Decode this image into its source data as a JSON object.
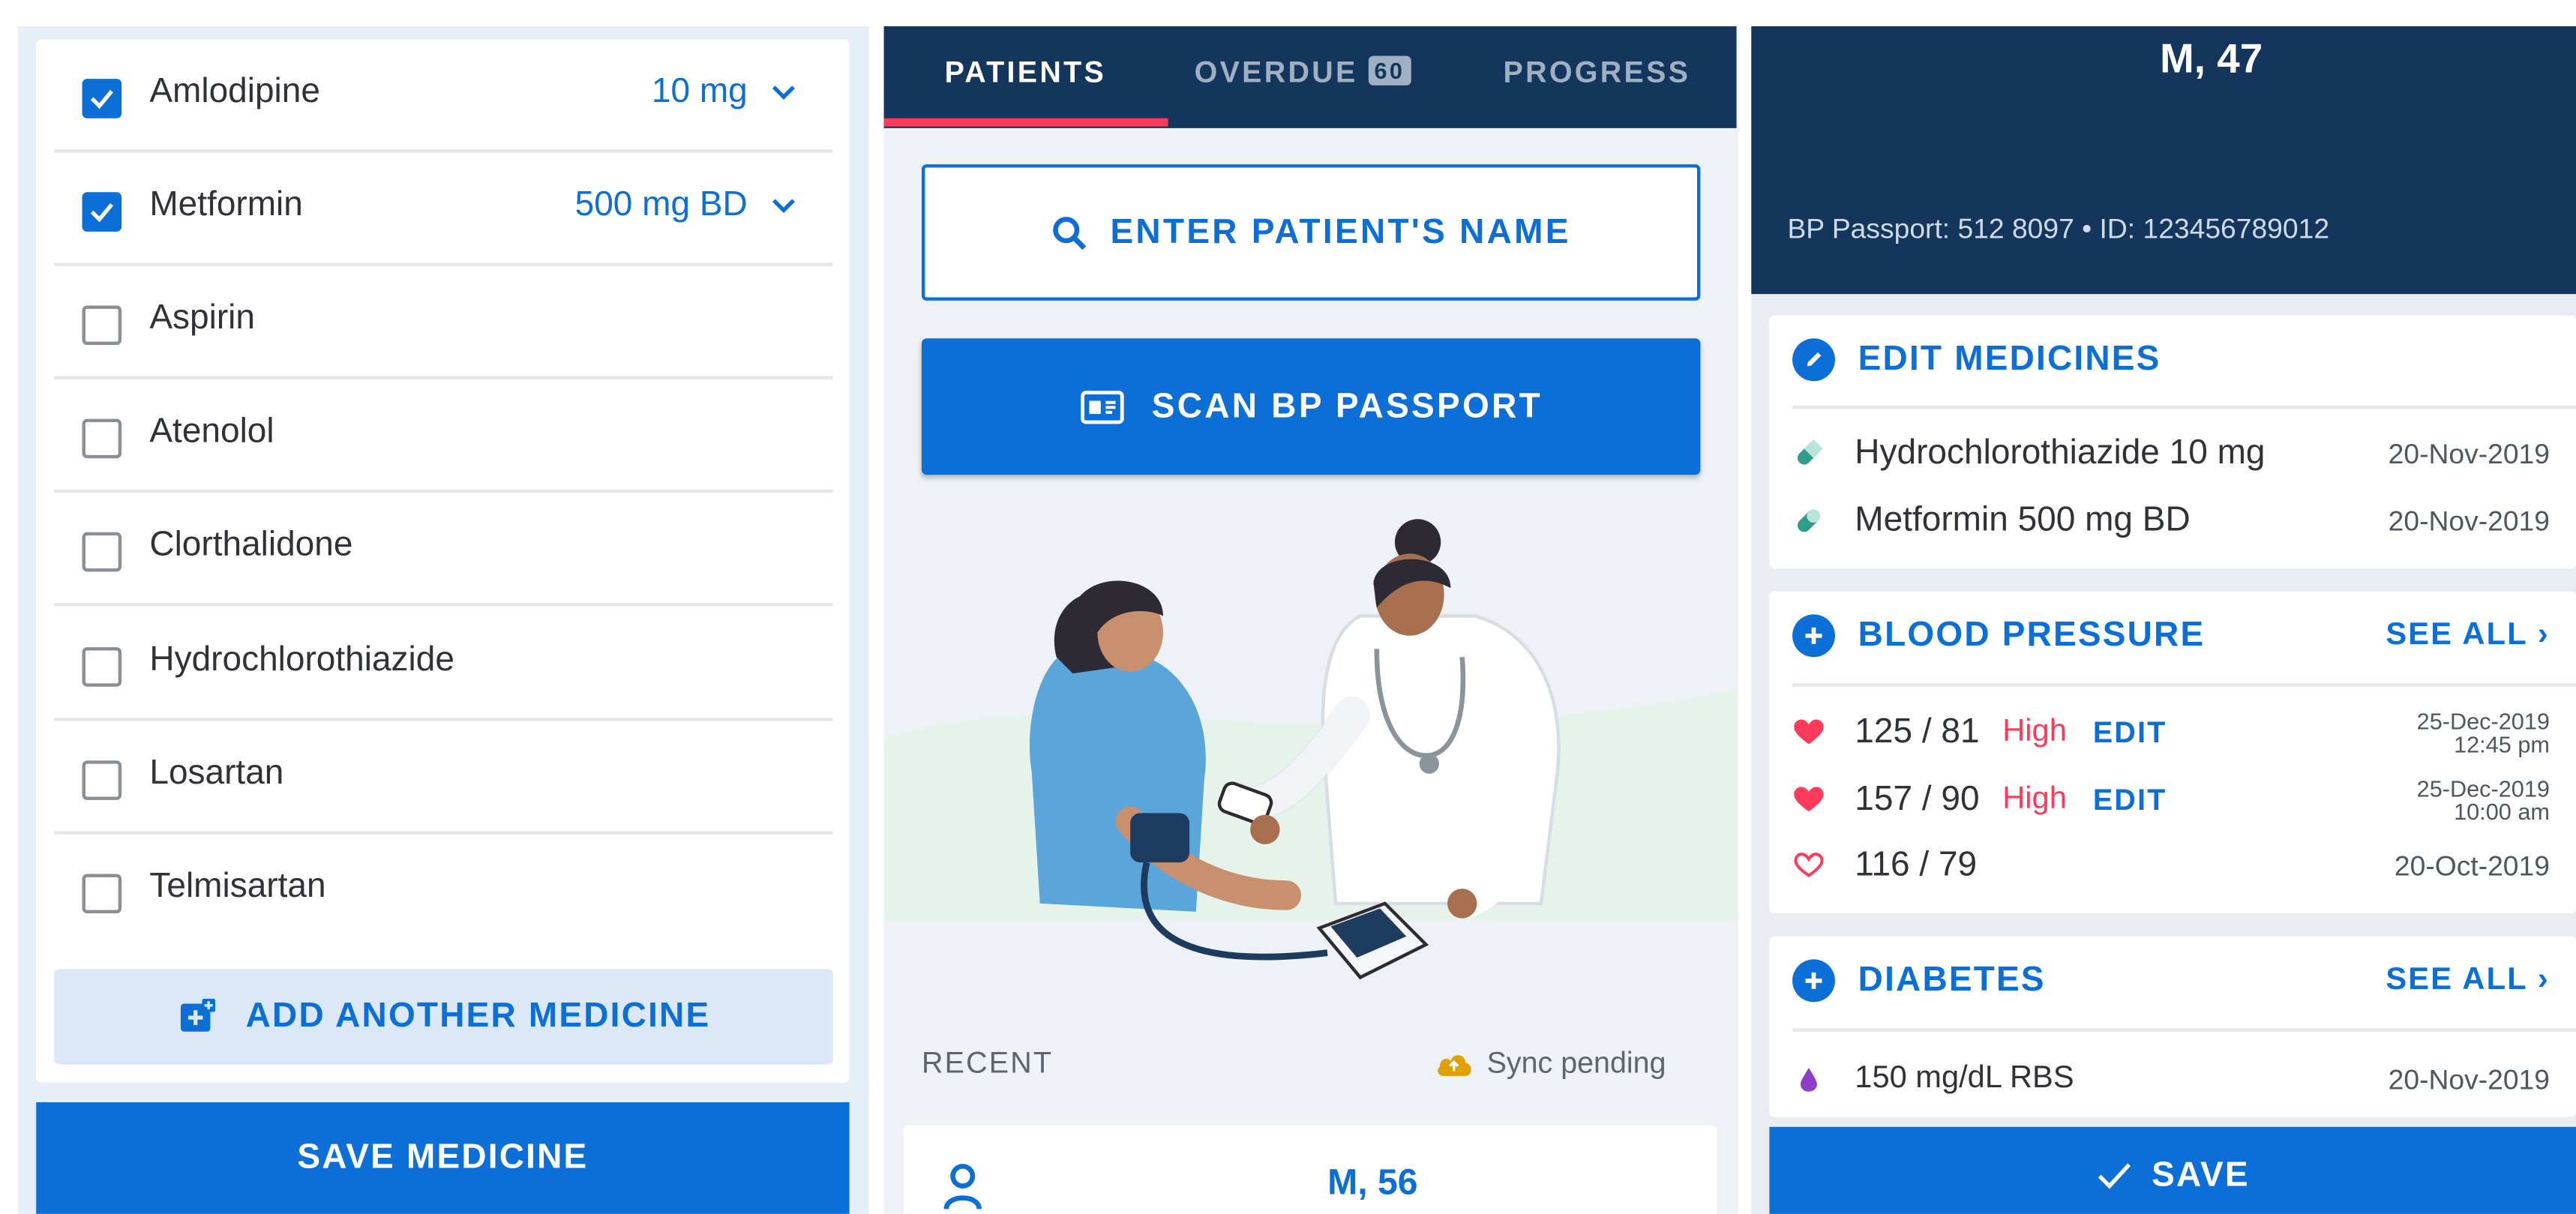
{
  "medicine_picker": {
    "items": [
      {
        "name": "Amlodipine",
        "checked": true,
        "dose": "10 mg"
      },
      {
        "name": "Metformin",
        "checked": true,
        "dose": "500 mg BD"
      },
      {
        "name": "Aspirin",
        "checked": false,
        "dose": ""
      },
      {
        "name": "Atenolol",
        "checked": false,
        "dose": ""
      },
      {
        "name": "Clorthalidone",
        "checked": false,
        "dose": ""
      },
      {
        "name": "Hydrochlorothiazide",
        "checked": false,
        "dose": ""
      },
      {
        "name": "Losartan",
        "checked": false,
        "dose": ""
      },
      {
        "name": "Telmisartan",
        "checked": false,
        "dose": ""
      }
    ],
    "add_label": "ADD ANOTHER MEDICINE",
    "save_label": "SAVE MEDICINE"
  },
  "home": {
    "tabs": [
      {
        "label": "PATIENTS",
        "active": true
      },
      {
        "label": "OVERDUE",
        "badge": "60",
        "active": false
      },
      {
        "label": "PROGRESS",
        "active": false
      }
    ],
    "search_label": "ENTER PATIENT'S NAME",
    "scan_label": "SCAN BP PASSPORT",
    "recent_label": "RECENT",
    "sync_status": "Sync pending",
    "recent_patient": "M, 56"
  },
  "patient_summary": {
    "title": "M, 47",
    "passport_line": "BP Passport: 512 8097  •  ID: 123456789012",
    "medicines": {
      "title": "EDIT MEDICINES",
      "items": [
        {
          "name": "Hydrochlorothiazide 10 mg",
          "date": "20-Nov-2019"
        },
        {
          "name": "Metformin 500 mg BD",
          "date": "20-Nov-2019"
        }
      ]
    },
    "blood_pressure": {
      "title": "BLOOD PRESSURE",
      "see_all": "SEE ALL",
      "readings": [
        {
          "value": "125 / 81",
          "flag": "High",
          "edit": "EDIT",
          "date": "25-Dec-2019",
          "time": "12:45 pm"
        },
        {
          "value": "157 / 90",
          "flag": "High",
          "edit": "EDIT",
          "date": "25-Dec-2019",
          "time": "10:00 am"
        },
        {
          "value": "116 / 79",
          "flag": "",
          "edit": "",
          "date": "20-Oct-2019",
          "time": ""
        }
      ]
    },
    "diabetes": {
      "title": "DIABETES",
      "see_all": "SEE ALL",
      "readings": [
        {
          "value": "150 mg/dL RBS",
          "date": "20-Nov-2019"
        }
      ]
    },
    "save_label": "SAVE"
  },
  "colors": {
    "primary": "#0c6fd8",
    "navy": "#14365c",
    "alert": "#ff3b5c"
  }
}
